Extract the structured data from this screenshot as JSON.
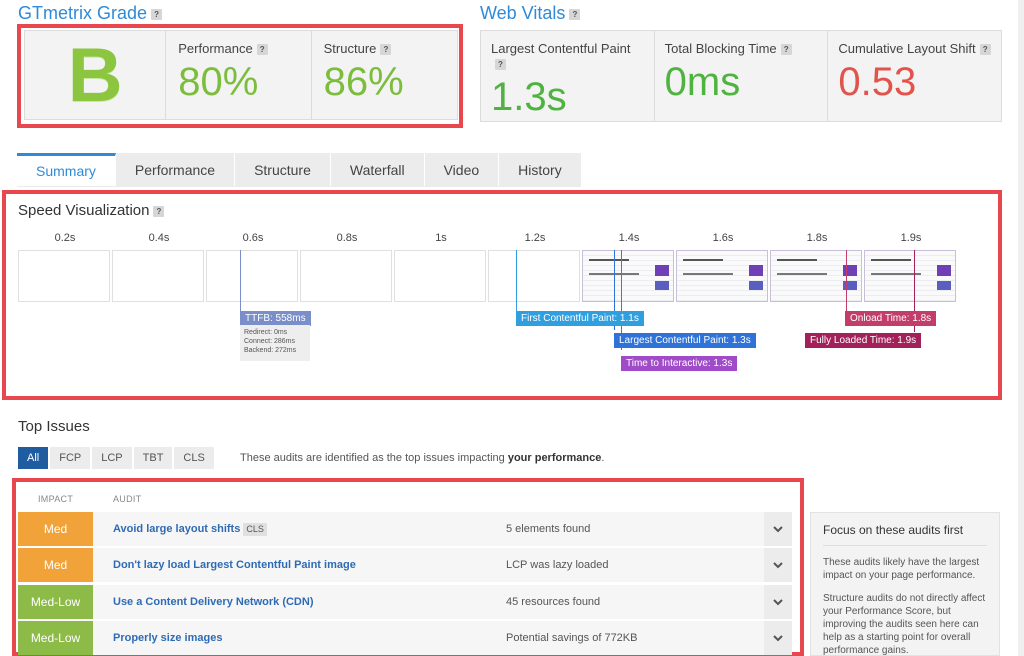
{
  "grade": {
    "title": "GTmetrix Grade",
    "letter": "B",
    "performance_label": "Performance",
    "performance_value": "80%",
    "structure_label": "Structure",
    "structure_value": "86%"
  },
  "vitals": {
    "title": "Web Vitals",
    "items": [
      {
        "label": "Largest Contentful Paint",
        "value": "1.3s"
      },
      {
        "label": "Total Blocking Time",
        "value": "0ms"
      },
      {
        "label": "Cumulative Layout Shift",
        "value": "0.53"
      }
    ]
  },
  "tabs": [
    "Summary",
    "Performance",
    "Structure",
    "Waterfall",
    "Video",
    "History"
  ],
  "speed": {
    "title": "Speed Visualization",
    "ticks": [
      "0.2s",
      "0.4s",
      "0.6s",
      "0.8s",
      "1s",
      "1.2s",
      "1.4s",
      "1.6s",
      "1.8s",
      "1.9s"
    ],
    "ttfb": "TTFB: 558ms",
    "ttfb_redirect": "Redirect: 0ms",
    "ttfb_connect": "Connect: 286ms",
    "ttfb_backend": "Backend: 272ms",
    "fcp": "First Contentful Paint: 1.1s",
    "lcp": "Largest Contentful Paint: 1.3s",
    "tti": "Time to Interactive: 1.3s",
    "onload": "Onload Time: 1.8s",
    "fully_loaded": "Fully Loaded Time: 1.9s"
  },
  "issues": {
    "title": "Top Issues",
    "filters": [
      "All",
      "FCP",
      "LCP",
      "TBT",
      "CLS"
    ],
    "desc_prefix": "These audits are identified as the top issues impacting",
    "desc_bold": "your performance",
    "desc_suffix": ".",
    "col_impact": "IMPACT",
    "col_audit": "AUDIT",
    "rows": [
      {
        "impact": "Med",
        "audit": "Avoid large layout shifts",
        "tag": "CLS",
        "finding": "5 elements found"
      },
      {
        "impact": "Med",
        "audit": "Don't lazy load Largest Contentful Paint image",
        "tag": "",
        "finding": "LCP was lazy loaded"
      },
      {
        "impact": "Med-Low",
        "audit": "Use a Content Delivery Network (CDN)",
        "tag": "",
        "finding": "45 resources found"
      },
      {
        "impact": "Med-Low",
        "audit": "Properly size images",
        "tag": "",
        "finding": "Potential savings of 772KB"
      }
    ]
  },
  "focus": {
    "title": "Focus on these audits first",
    "p1": "These audits likely have the largest impact on your page performance.",
    "p2": "Structure audits do not directly affect your Performance Score, but improving the audits seen here can help as a starting point for overall performance gains."
  },
  "colors": {
    "accent": "#2f8ad8",
    "highlight": "#e8474e",
    "good": "#4eb33f",
    "bad": "#e2534b",
    "fcp": "#2f9fe0",
    "lcp": "#2f73d8",
    "tti": "#a04bc8",
    "onload": "#c23d6a",
    "fully_loaded": "#a3215a"
  }
}
